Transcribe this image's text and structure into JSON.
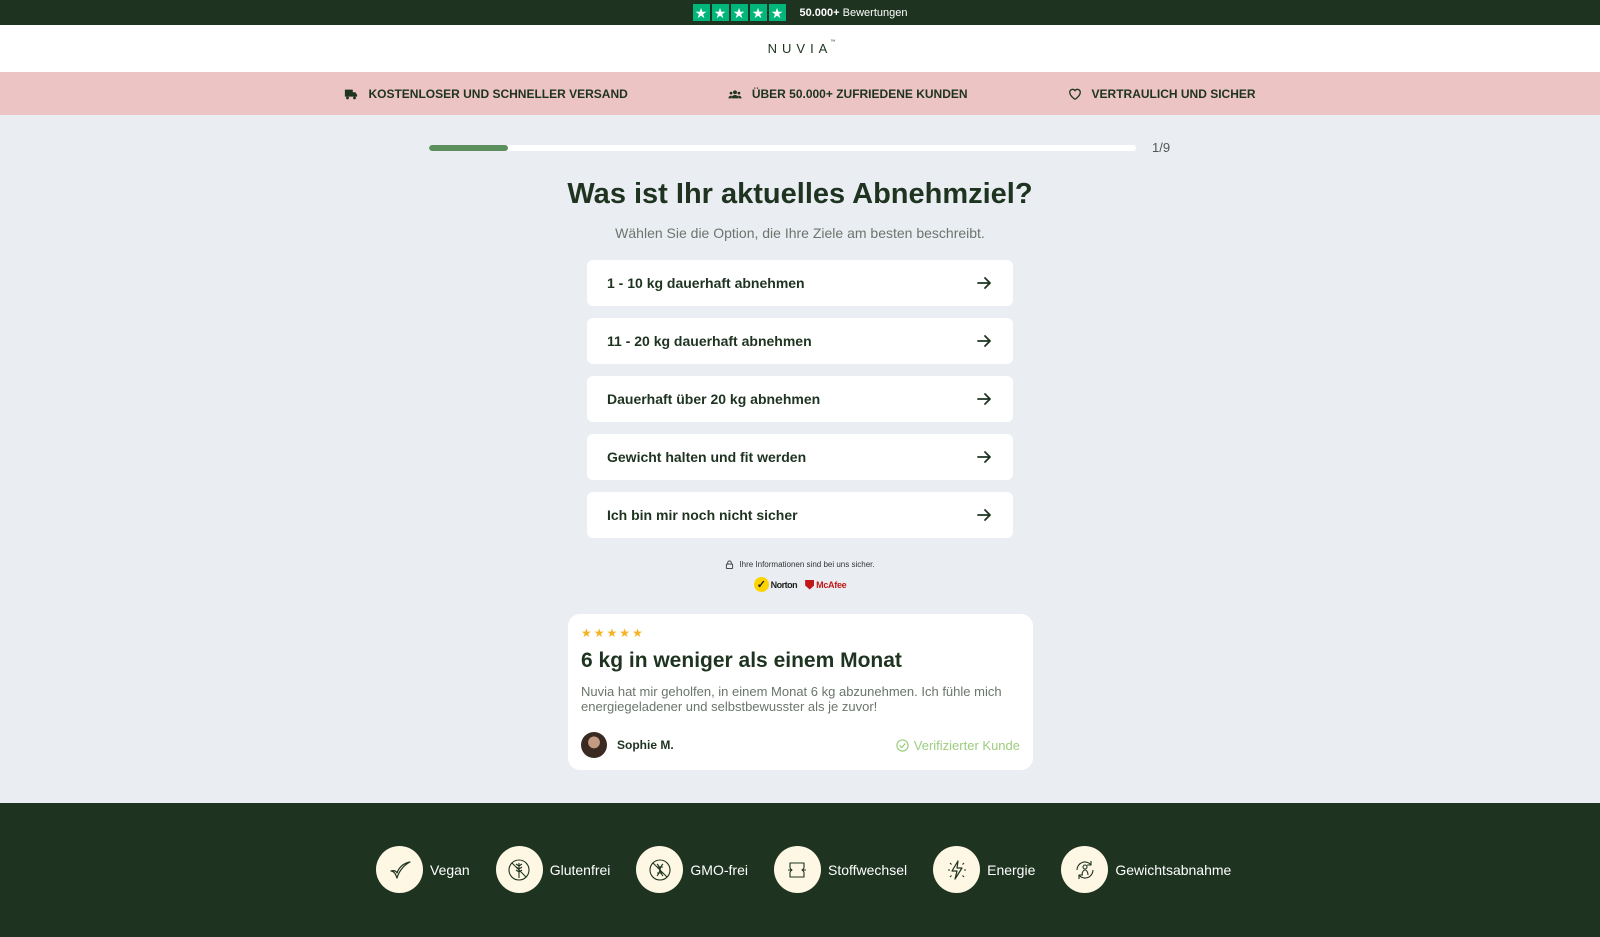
{
  "topbar": {
    "stars": [
      "★",
      "★",
      "★",
      "★",
      "★"
    ],
    "reviews_count": "50.000+",
    "reviews_label": "Bewertungen",
    "trustpilot_color": "#00b67a"
  },
  "header": {
    "logo": "NUVIA",
    "logo_mark": "™"
  },
  "benefits": [
    {
      "icon": "truck-icon",
      "label": "KOSTENLOSER UND SCHNELLER VERSAND"
    },
    {
      "icon": "users-icon",
      "label": "ÜBER 50.000+ ZUFRIEDENE KUNDEN"
    },
    {
      "icon": "heart-icon",
      "label": "VERTRAULICH UND SICHER"
    }
  ],
  "progress": {
    "label": "1/9",
    "current": 1,
    "total": 9
  },
  "question": {
    "title": "Was ist Ihr aktuelles Abnehmziel?",
    "subtitle": "Wählen Sie die Option, die Ihre Ziele am besten beschreibt."
  },
  "options": [
    {
      "label": "1 - 10 kg dauerhaft abnehmen"
    },
    {
      "label": "11 - 20 kg dauerhaft abnehmen"
    },
    {
      "label": "Dauerhaft über 20 kg abnehmen"
    },
    {
      "label": "Gewicht halten und fit werden"
    },
    {
      "label": "Ich bin mir noch nicht sicher"
    }
  ],
  "security": {
    "text": "Ihre Informationen sind bei uns sicher.",
    "badges": [
      "Norton",
      "McAfee"
    ]
  },
  "review": {
    "rating": 5,
    "title": "6 kg in weniger als einem Monat",
    "text": "Nuvia hat mir geholfen, in einem Monat 6 kg abzunehmen. Ich fühle mich energiegeladener und selbstbewusster als je zuvor!",
    "author": "Sophie M.",
    "verified_label": "Verifizierter Kunde"
  },
  "features": [
    {
      "icon": "leaf-icon",
      "label": "Vegan"
    },
    {
      "icon": "wheat-icon",
      "label": "Glutenfrei"
    },
    {
      "icon": "gmo-free-icon",
      "label": "GMO-frei"
    },
    {
      "icon": "metabolism-icon",
      "label": "Stoffwechsel"
    },
    {
      "icon": "energy-icon",
      "label": "Energie"
    },
    {
      "icon": "weight-loss-icon",
      "label": "Gewichtsabnahme"
    }
  ],
  "colors": {
    "brand_dark": "#1e3320",
    "banner_pink": "#ebc4c3",
    "progress": "#5b8f5d",
    "star": "#f5b324",
    "verified": "#9ccc7e"
  }
}
